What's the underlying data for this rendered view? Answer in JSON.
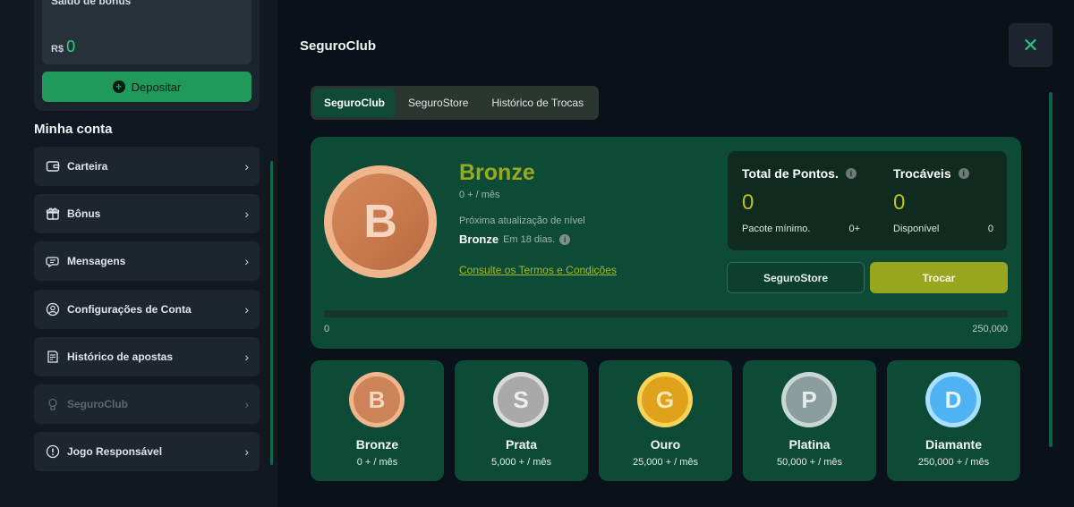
{
  "sidebar": {
    "bonus_title": "Saldo de bônus",
    "bonus_currency": "R$",
    "bonus_amount": "0",
    "deposit_label": "Depositar",
    "section_title": "Minha conta",
    "items": [
      {
        "label": "Carteira",
        "icon": "wallet-icon"
      },
      {
        "label": "Bônus",
        "icon": "gift-icon"
      },
      {
        "label": "Mensagens",
        "icon": "messages-icon"
      },
      {
        "label": "Configurações de Conta",
        "icon": "user-settings-icon"
      },
      {
        "label": "Histórico de apostas",
        "icon": "bet-history-icon"
      },
      {
        "label": "SeguroClub",
        "icon": "club-icon",
        "muted": true
      },
      {
        "label": "Jogo Responsável",
        "icon": "alert-circle-icon"
      }
    ]
  },
  "modal": {
    "title": "SeguroClub",
    "tabs": [
      "SeguroClub",
      "SeguroStore",
      "Histórico de Trocas"
    ],
    "active_tab": "SeguroClub"
  },
  "level": {
    "name": "Bronze",
    "requirement": "0 + / mês",
    "next_label": "Próxima atualização de nível",
    "next_level": "Bronze",
    "next_in": "Em 18 dias.",
    "terms": "Consulte os Termos e Condições",
    "coin_letter": "B"
  },
  "points": {
    "total_label": "Total de Pontos.",
    "total_value": "0",
    "min_pack_label": "Pacote mínimo.",
    "min_pack_value": "0+",
    "tradeable_label": "Trocáveis",
    "tradeable_value": "0",
    "available_label": "Disponível",
    "available_value": "0"
  },
  "buttons": {
    "store": "SeguroStore",
    "trade": "Trocar"
  },
  "progress": {
    "min": "0",
    "max": "250,000",
    "fraction": 0
  },
  "tiers": [
    {
      "letter": "B",
      "name": "Bronze",
      "requirement": "0 + / mês",
      "ring": "#f0b58c",
      "fill": "#cd8358",
      "text": "#f6d6bf"
    },
    {
      "letter": "S",
      "name": "Prata",
      "requirement": "5,000 + / mês",
      "ring": "#d9d9d9",
      "fill": "#a9a9a9",
      "text": "#eeeeee"
    },
    {
      "letter": "G",
      "name": "Ouro",
      "requirement": "25,000 + / mês",
      "ring": "#f8d35a",
      "fill": "#e0a21a",
      "text": "#fbe8b0"
    },
    {
      "letter": "P",
      "name": "Platina",
      "requirement": "50,000 + / mês",
      "ring": "#c9d6d6",
      "fill": "#8a9c9c",
      "text": "#e4ecec"
    },
    {
      "letter": "D",
      "name": "Diamante",
      "requirement": "250,000 + / mês",
      "ring": "#a9e0ff",
      "fill": "#4fb2f2",
      "text": "#e3f5ff"
    }
  ]
}
